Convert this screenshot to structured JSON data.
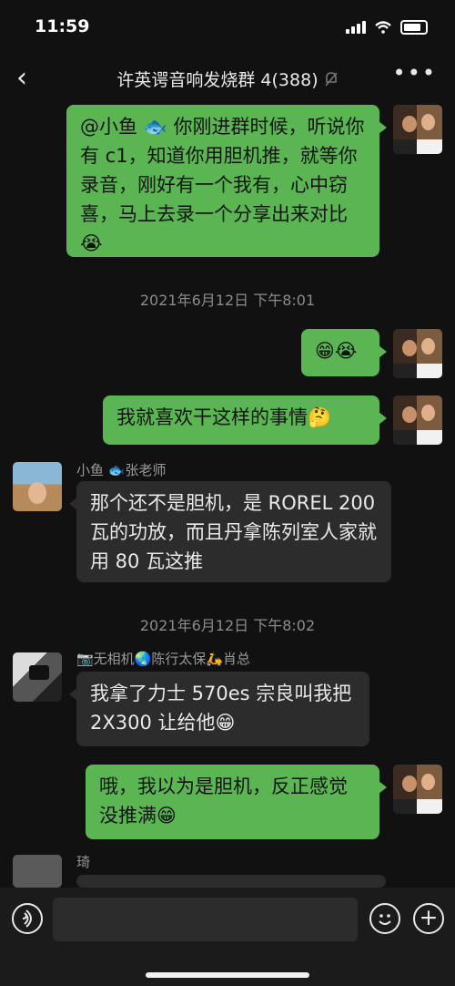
{
  "status": {
    "time": "11:59"
  },
  "chat": {
    "title": "许英谔音响发烧群 4(388)"
  },
  "messages": [
    {
      "text": "@小鱼 🐟 你刚进群时候，听说你有 c1，知道你用胆机推，就等你录音，刚好有一个我有，心中窃喜，马上去录一个分享出来对比😭"
    },
    {
      "text": "😁😭"
    },
    {
      "text": "我就喜欢干这样的事情🤔"
    },
    {
      "sender": "小鱼 🐟张老师",
      "text": "那个还不是胆机，是 ROREL 200 瓦的功放，而且丹拿陈列室人家就用 80 瓦这推"
    },
    {
      "sender": "📷无相机🌏陈行太保🛵肖总",
      "text": "我拿了力士 570es 宗良叫我把 2X300 让给他😁"
    },
    {
      "text": "哦，我以为是胆机，反正感觉没推满😁"
    },
    {
      "sender": "琦",
      "text": ""
    }
  ],
  "timestamps": [
    "2021年6月12日 下午8:01",
    "2021年6月12日 下午8:02"
  ],
  "icons": {
    "back": "chevron-left-icon",
    "more": "more-icon",
    "mute": "mute-bell-icon",
    "voice": "voice-icon",
    "emoji": "emoji-icon",
    "plus": "plus-icon"
  }
}
